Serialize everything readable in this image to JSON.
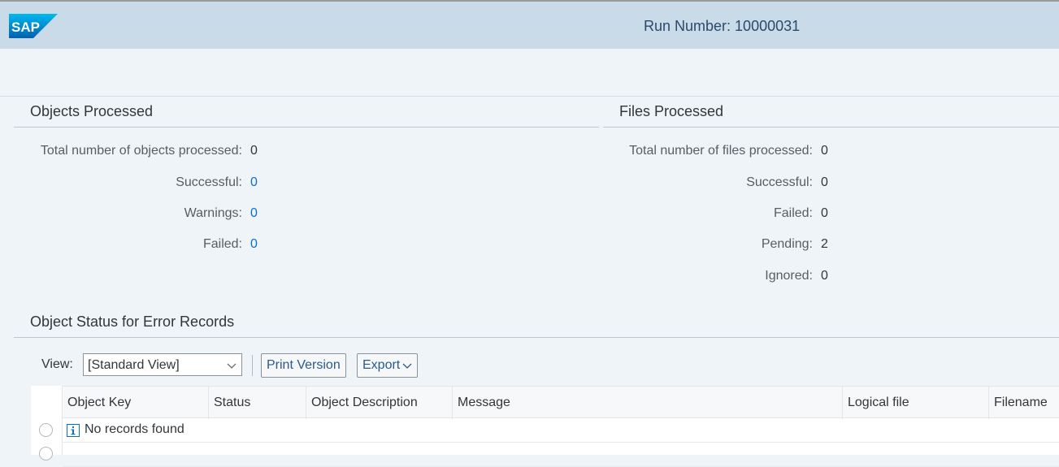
{
  "header": {
    "logo_text": "SAP",
    "run_number": "Run Number: 10000031",
    "brand_color": "#0a6ed1"
  },
  "objects_processed": {
    "title": "Objects Processed",
    "rows": [
      {
        "label": "Total number of objects processed:",
        "value": "0"
      },
      {
        "label": "Successful:",
        "value": "0"
      },
      {
        "label": "Warnings:",
        "value": "0"
      },
      {
        "label": "Failed:",
        "value": "0"
      }
    ]
  },
  "files_processed": {
    "title": "Files Processed",
    "rows": [
      {
        "label": "Total number of files processed:",
        "value": "0"
      },
      {
        "label": "Successful:",
        "value": "0"
      },
      {
        "label": "Failed:",
        "value": "0"
      },
      {
        "label": "Pending:",
        "value": "2"
      },
      {
        "label": "Ignored:",
        "value": "0"
      }
    ]
  },
  "error_records": {
    "title": "Object Status for Error Records",
    "toolbar": {
      "view_label": "View:",
      "view_selected": "[Standard View]",
      "print_label": "Print Version",
      "export_label": "Export"
    },
    "columns": [
      "Object Key",
      "Status",
      "Object Description",
      "Message",
      "Logical file",
      "Filename"
    ],
    "empty_message": "No records found"
  }
}
